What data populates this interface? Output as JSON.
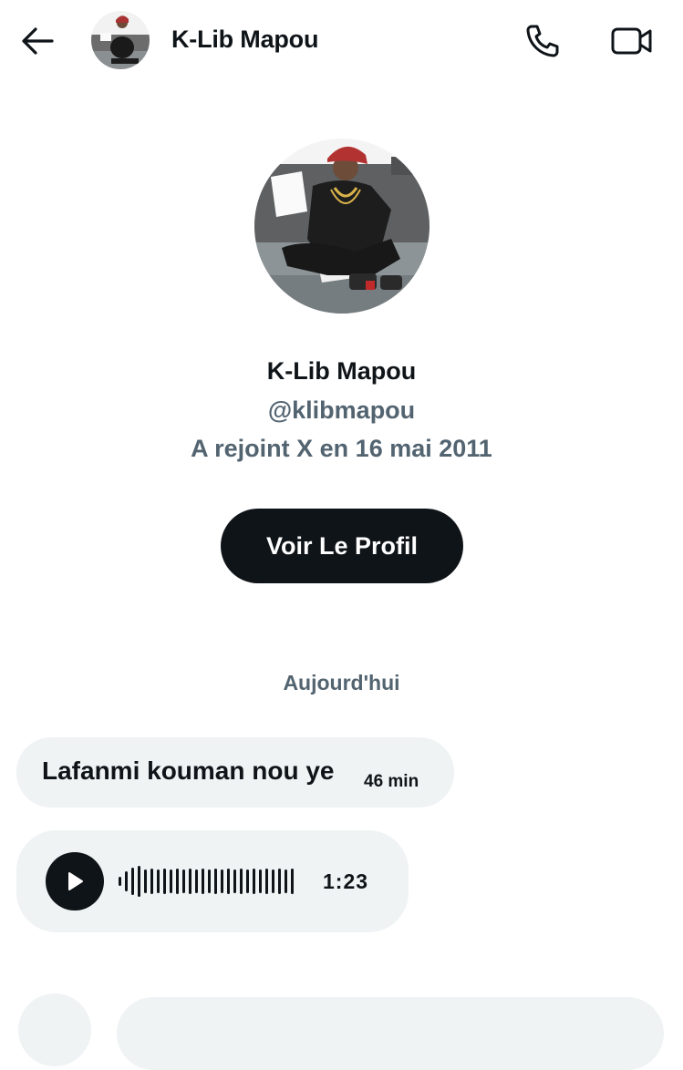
{
  "header": {
    "back_icon": "arrow-left-icon",
    "name": "K-Lib Mapou",
    "call_icon": "phone-icon",
    "video_icon": "video-camera-icon"
  },
  "profile": {
    "name": "K-Lib Mapou",
    "handle": "@klibmapou",
    "joined": "A rejoint X en 16 mai 2011",
    "button_label": "Voir Le Profil"
  },
  "conversation": {
    "date_divider": "Aujourd'hui",
    "messages": [
      {
        "text": "Lafanmi kouman nou ye",
        "time": "46 min"
      }
    ],
    "voice_message": {
      "play_icon": "play-icon",
      "duration": "1:23"
    }
  },
  "colors": {
    "primary_text": "#0f1419",
    "secondary_text": "#536471",
    "bubble_bg": "#eff3f4",
    "button_bg": "#0f1419"
  }
}
